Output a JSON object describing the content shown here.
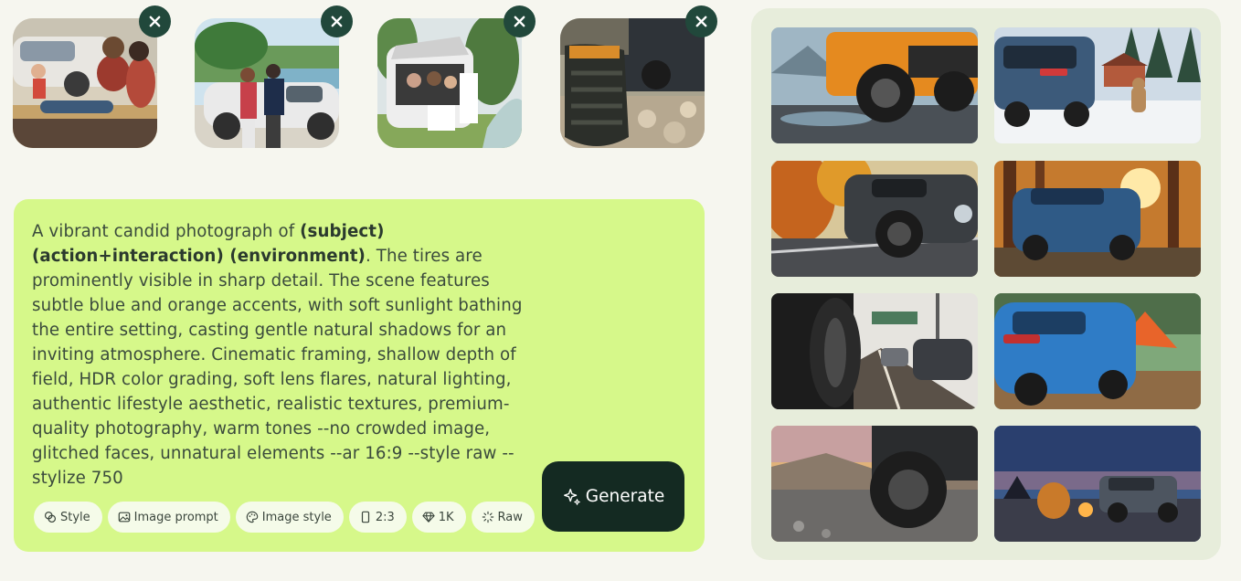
{
  "reference_images": [
    {
      "name": "family picnic by a car",
      "remove_icon": "close-icon"
    },
    {
      "name": "couple walking by a lake with car",
      "remove_icon": "close-icon"
    },
    {
      "name": "family in open SUV trunk",
      "remove_icon": "close-icon"
    },
    {
      "name": "hiking boot next to off-road car",
      "remove_icon": "close-icon"
    }
  ],
  "prompt": {
    "text_segments": [
      {
        "text": "A vibrant candid photograph of ",
        "bold": false
      },
      {
        "text": "(subject) (action+interaction) (environment)",
        "bold": true
      },
      {
        "text": ". The tires are prominently visible in sharp detail. The scene features subtle blue and orange accents, with soft sunlight bathing the entire setting, casting gentle natural shadows for an inviting atmosphere. Cinematic framing, shallow depth of field, HDR color grading, soft lens flares, natural lighting, authentic lifestyle aesthetic, realistic textures, premium-quality photography, warm tones --no crowded image, glitched faces, unnatural elements --ar 16:9 --style raw --stylize 750",
        "bold": false
      }
    ]
  },
  "options": [
    {
      "label": "Style",
      "icon": "style-icon"
    },
    {
      "label": "Image prompt",
      "icon": "image-icon"
    },
    {
      "label": "Image style",
      "icon": "palette-icon"
    },
    {
      "label": "2:3",
      "icon": "aspect-ratio-icon"
    },
    {
      "label": "1K",
      "icon": "diamond-icon"
    },
    {
      "label": "Raw",
      "icon": "raw-icon"
    }
  ],
  "generate": {
    "label": "Generate",
    "icon": "sparkle-icon"
  },
  "results": [
    {
      "name": "orange jeep tire in mud"
    },
    {
      "name": "blue car on snowy road with dog"
    },
    {
      "name": "dark car on autumn road"
    },
    {
      "name": "blue car in sunlit forest"
    },
    {
      "name": "car tire on highway"
    },
    {
      "name": "blue car at campsite with tent"
    },
    {
      "name": "off-road tire at sunset"
    },
    {
      "name": "SUV by campfire at dusk"
    }
  ],
  "colors": {
    "background": "#f6f6ef",
    "prompt_card": "#d6f88a",
    "generate_button": "#142a22",
    "close_button": "#21483b",
    "results_panel": "#e7eddb"
  }
}
